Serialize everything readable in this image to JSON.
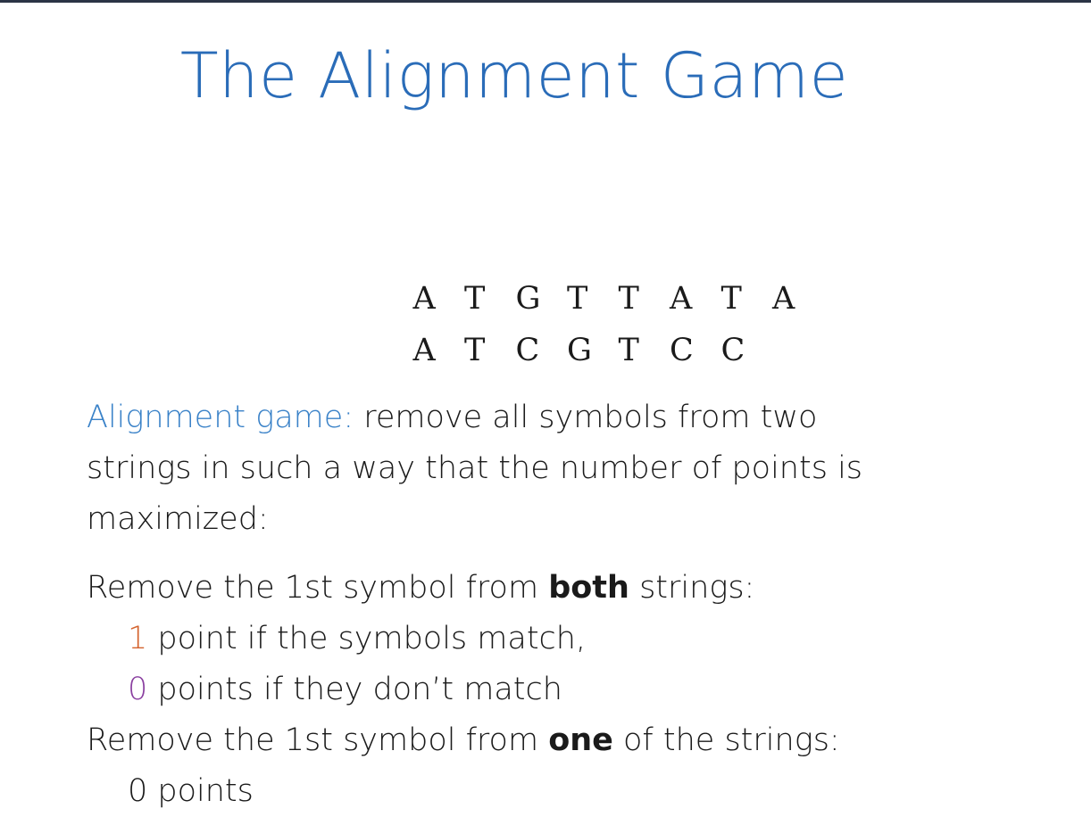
{
  "slide": {
    "title": "The Alignment Game",
    "sequences": {
      "first": [
        "A",
        "T",
        "G",
        "T",
        "T",
        "A",
        "T",
        "A"
      ],
      "second": [
        "A",
        "T",
        "C",
        "G",
        "T",
        "C",
        "C"
      ]
    },
    "description": {
      "term": "Alignment game:",
      "line1_rest": " remove all symbols from two",
      "line2": "strings in such a way that the number of points is",
      "line3": "maximized:"
    },
    "rule_both": {
      "prefix": "Remove the 1st symbol from ",
      "emphasis": "both",
      "suffix": " strings:"
    },
    "rule_match": {
      "value": "1",
      "text": " point if the symbols match,"
    },
    "rule_mismatch": {
      "value": "0",
      "text": " points if they don’t match"
    },
    "rule_one": {
      "prefix": "Remove the 1st symbol from ",
      "emphasis": "one",
      "suffix": " of the strings:"
    },
    "rule_one_points": "0 points"
  },
  "colors": {
    "title": "#2a6cb8",
    "term": "#3a82c8",
    "match_value": "#d4632e",
    "mismatch_value": "#8a3fa0"
  }
}
